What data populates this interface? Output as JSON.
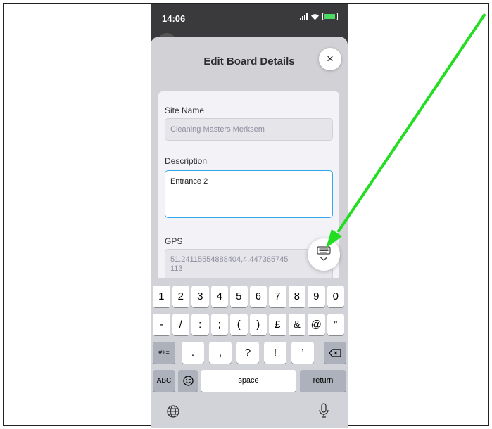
{
  "status": {
    "time": "14:06"
  },
  "sheet": {
    "title": "Edit Board Details",
    "close_label": "×"
  },
  "form": {
    "site_name": {
      "label": "Site Name",
      "value": "Cleaning Masters Merksem"
    },
    "description": {
      "label": "Description",
      "value": "Entrance 2"
    },
    "gps": {
      "label": "GPS",
      "value_line1": "51.24115554888404,4.447365745",
      "value_line2": "113"
    }
  },
  "keyboard": {
    "row1": [
      "1",
      "2",
      "3",
      "4",
      "5",
      "6",
      "7",
      "8",
      "9",
      "0"
    ],
    "row2": [
      "-",
      "/",
      ":",
      ";",
      "(",
      ")",
      "£",
      "&",
      "@",
      "”"
    ],
    "row3_symbols": "#+=",
    "row3": [
      ".",
      ",",
      "?",
      "!",
      "’"
    ],
    "abc_label": "ABC",
    "space_label": "space",
    "return_label": "return"
  },
  "annotation": {
    "arrow_color": "#22dd22"
  }
}
